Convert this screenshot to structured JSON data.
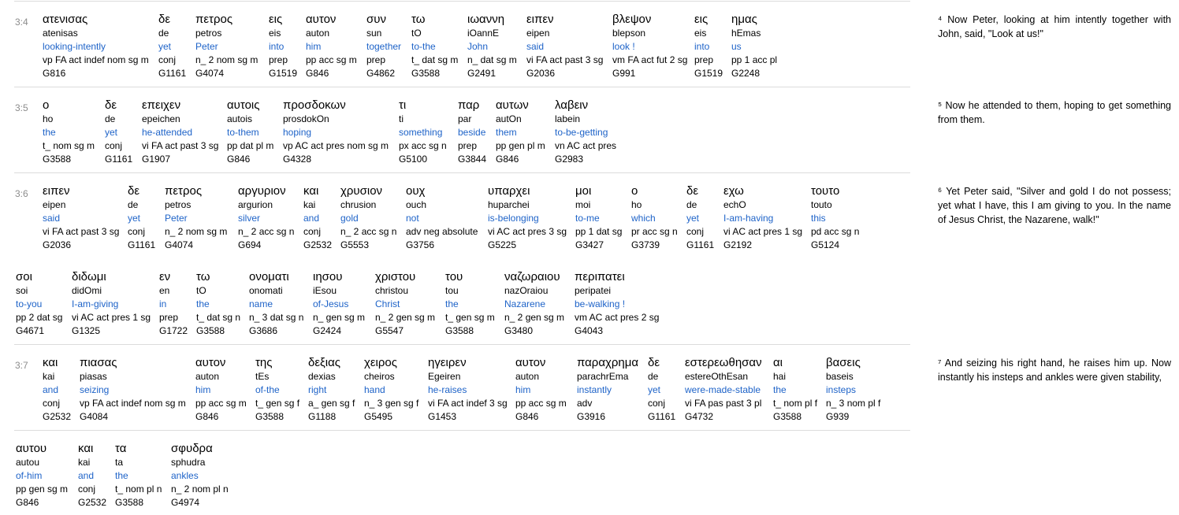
{
  "verses": [
    {
      "ref": "3:4",
      "rows": [
        [
          {
            "g": "ατενισας",
            "t": "atenisas",
            "e": "looking-intently",
            "p": "vp FA act indef nom sg m",
            "s": "G816"
          },
          {
            "g": "δε",
            "t": "de",
            "e": "yet",
            "p": "conj",
            "s": "G1161"
          },
          {
            "g": "πετρος",
            "t": "petros",
            "e": "Peter",
            "p": "n_ 2 nom sg m",
            "s": "G4074"
          },
          {
            "g": "εις",
            "t": "eis",
            "e": "into",
            "p": "prep",
            "s": "G1519"
          },
          {
            "g": "αυτον",
            "t": "auton",
            "e": "him",
            "p": "pp acc sg m",
            "s": "G846"
          },
          {
            "g": "συν",
            "t": "sun",
            "e": "together",
            "p": "prep",
            "s": "G4862"
          },
          {
            "g": "τω",
            "t": "tO",
            "e": "to-the",
            "p": "t_ dat sg m",
            "s": "G3588"
          },
          {
            "g": "ιωαννη",
            "t": "iOannE",
            "e": "John",
            "p": "n_ dat sg m",
            "s": "G2491"
          },
          {
            "g": "ειπεν",
            "t": "eipen",
            "e": "said",
            "p": "vi FA act past 3 sg",
            "s": "G2036"
          },
          {
            "g": "βλεψον",
            "t": "blepson",
            "e": "look !",
            "p": "vm FA act fut 2 sg",
            "s": "G991"
          },
          {
            "g": "εις",
            "t": "eis",
            "e": "into",
            "p": "prep",
            "s": "G1519"
          },
          {
            "g": "ημας",
            "t": "hEmas",
            "e": "us",
            "p": "pp 1 acc pl",
            "s": "G2248"
          }
        ]
      ],
      "translation": "⁴ Now Peter, looking at him intently together with John, said, \"Look at us!\""
    },
    {
      "ref": "3:5",
      "rows": [
        [
          {
            "g": "ο",
            "t": "ho",
            "e": "the",
            "p": "t_ nom sg m",
            "s": "G3588"
          },
          {
            "g": "δε",
            "t": "de",
            "e": "yet",
            "p": "conj",
            "s": "G1161"
          },
          {
            "g": "επειχεν",
            "t": "epeichen",
            "e": "he-attended",
            "p": "vi FA act past 3 sg",
            "s": "G1907"
          },
          {
            "g": "αυτοις",
            "t": "autois",
            "e": "to-them",
            "p": "pp dat pl m",
            "s": "G846"
          },
          {
            "g": "προσδοκων",
            "t": "prosdokOn",
            "e": "hoping",
            "p": "vp AC act pres nom sg m",
            "s": "G4328"
          },
          {
            "g": "τι",
            "t": "ti",
            "e": "something",
            "p": "px acc sg n",
            "s": "G5100"
          },
          {
            "g": "παρ",
            "t": "par",
            "e": "beside",
            "p": "prep",
            "s": "G3844"
          },
          {
            "g": "αυτων",
            "t": "autOn",
            "e": "them",
            "p": "pp gen pl m",
            "s": "G846"
          },
          {
            "g": "λαβειν",
            "t": "labein",
            "e": "to-be-getting",
            "p": "vn AC act pres",
            "s": "G2983"
          }
        ]
      ],
      "translation": "⁵ Now he attended to them, hoping to get something from them."
    },
    {
      "ref": "3:6",
      "rows": [
        [
          {
            "g": "ειπεν",
            "t": "eipen",
            "e": "said",
            "p": "vi FA act past 3 sg",
            "s": "G2036"
          },
          {
            "g": "δε",
            "t": "de",
            "e": "yet",
            "p": "conj",
            "s": "G1161"
          },
          {
            "g": "πετρος",
            "t": "petros",
            "e": "Peter",
            "p": "n_ 2 nom sg m",
            "s": "G4074"
          },
          {
            "g": "αργυριον",
            "t": "argurion",
            "e": "silver",
            "p": "n_ 2 acc sg n",
            "s": "G694"
          },
          {
            "g": "και",
            "t": "kai",
            "e": "and",
            "p": "conj",
            "s": "G2532"
          },
          {
            "g": "χρυσιον",
            "t": "chrusion",
            "e": "gold",
            "p": "n_ 2 acc sg n",
            "s": "G5553"
          },
          {
            "g": "ουχ",
            "t": "ouch",
            "e": "not",
            "p": "adv neg absolute",
            "s": "G3756"
          },
          {
            "g": "υπαρχει",
            "t": "huparchei",
            "e": "is-belonging",
            "p": "vi AC act pres 3 sg",
            "s": "G5225"
          },
          {
            "g": "μοι",
            "t": "moi",
            "e": "to-me",
            "p": "pp 1 dat sg",
            "s": "G3427"
          },
          {
            "g": "ο",
            "t": "ho",
            "e": "which",
            "p": "pr acc sg n",
            "s": "G3739"
          },
          {
            "g": "δε",
            "t": "de",
            "e": "yet",
            "p": "conj",
            "s": "G1161"
          },
          {
            "g": "εχω",
            "t": "echO",
            "e": "I-am-having",
            "p": "vi AC act pres 1 sg",
            "s": "G2192"
          },
          {
            "g": "τουτο",
            "t": "touto",
            "e": "this",
            "p": "pd acc sg n",
            "s": "G5124"
          }
        ],
        [
          {
            "g": "σοι",
            "t": "soi",
            "e": "to-you",
            "p": "pp 2 dat sg",
            "s": "G4671"
          },
          {
            "g": "διδωμι",
            "t": "didOmi",
            "e": "I-am-giving",
            "p": "vi AC act pres 1 sg",
            "s": "G1325"
          },
          {
            "g": "εν",
            "t": "en",
            "e": "in",
            "p": "prep",
            "s": "G1722"
          },
          {
            "g": "τω",
            "t": "tO",
            "e": "the",
            "p": "t_ dat sg n",
            "s": "G3588"
          },
          {
            "g": "ονοματι",
            "t": "onomati",
            "e": "name",
            "p": "n_ 3 dat sg n",
            "s": "G3686"
          },
          {
            "g": "ιησου",
            "t": "iEsou",
            "e": "of-Jesus",
            "p": "n_ gen sg m",
            "s": "G2424"
          },
          {
            "g": "χριστου",
            "t": "christou",
            "e": "Christ",
            "p": "n_ 2 gen sg m",
            "s": "G5547"
          },
          {
            "g": "του",
            "t": "tou",
            "e": "the",
            "p": "t_ gen sg m",
            "s": "G3588"
          },
          {
            "g": "ναζωραιου",
            "t": "nazOraiou",
            "e": "Nazarene",
            "p": "n_ 2 gen sg m",
            "s": "G3480"
          },
          {
            "g": "περιπατει",
            "t": "peripatei",
            "e": "be-walking !",
            "p": "vm AC act pres 2 sg",
            "s": "G4043"
          }
        ]
      ],
      "translation": "⁶ Yet Peter said, \"Silver and gold I do not possess; yet what I have, this I am giving to you. In the name of Jesus Christ, the Nazarene, walk!\""
    },
    {
      "ref": "3:7",
      "rows": [
        [
          {
            "g": "και",
            "t": "kai",
            "e": "and",
            "p": "conj",
            "s": "G2532"
          },
          {
            "g": "πιασας",
            "t": "piasas",
            "e": "seizing",
            "p": "vp FA act indef nom sg m",
            "s": "G4084"
          },
          {
            "g": "αυτον",
            "t": "auton",
            "e": "him",
            "p": "pp acc sg m",
            "s": "G846"
          },
          {
            "g": "της",
            "t": "tEs",
            "e": "of-the",
            "p": "t_ gen sg f",
            "s": "G3588"
          },
          {
            "g": "δεξιας",
            "t": "dexias",
            "e": "right",
            "p": "a_ gen sg f",
            "s": "G1188"
          },
          {
            "g": "χειρος",
            "t": "cheiros",
            "e": "hand",
            "p": "n_ 3 gen sg f",
            "s": "G5495"
          },
          {
            "g": "ηγειρεν",
            "t": "Egeiren",
            "e": "he-raises",
            "p": "vi FA act indef 3 sg",
            "s": "G1453"
          },
          {
            "g": "αυτον",
            "t": "auton",
            "e": "him",
            "p": "pp acc sg m",
            "s": "G846"
          },
          {
            "g": "παραχρημα",
            "t": "parachrEma",
            "e": "instantly",
            "p": "adv",
            "s": "G3916"
          },
          {
            "g": "δε",
            "t": "de",
            "e": "yet",
            "p": "conj",
            "s": "G1161"
          },
          {
            "g": "εστερεωθησαν",
            "t": "estereOthEsan",
            "e": "were-made-stable",
            "p": "vi FA pas past 3 pl",
            "s": "G4732"
          },
          {
            "g": "αι",
            "t": "hai",
            "e": "the",
            "p": "t_ nom pl f",
            "s": "G3588"
          },
          {
            "g": "βασεις",
            "t": "baseis",
            "e": "insteps",
            "p": "n_ 3 nom pl f",
            "s": "G939"
          }
        ],
        [
          {
            "g": "αυτου",
            "t": "autou",
            "e": "of-him",
            "p": "pp gen sg m",
            "s": "G846"
          },
          {
            "g": "και",
            "t": "kai",
            "e": "and",
            "p": "conj",
            "s": "G2532"
          },
          {
            "g": "τα",
            "t": "ta",
            "e": "the",
            "p": "t_ nom pl n",
            "s": "G3588"
          },
          {
            "g": "σφυδρα",
            "t": "sphudra",
            "e": "ankles",
            "p": "n_ 2 nom pl n",
            "s": "G4974"
          }
        ]
      ],
      "translation": "⁷ And seizing his right hand, he raises him up. Now instantly his insteps and ankles were given stability,"
    }
  ]
}
